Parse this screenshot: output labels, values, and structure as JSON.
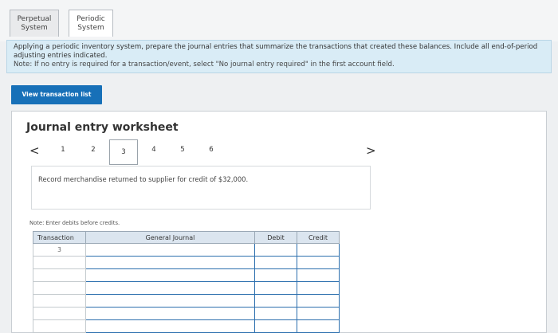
{
  "tabs": [
    {
      "label_line1": "Perpetual",
      "label_line2": "System"
    },
    {
      "label_line1": "Periodic",
      "label_line2": "System"
    }
  ],
  "instructions": {
    "line1": "Applying a periodic inventory system, prepare the journal entries that summarize the transactions that created these balances. Include all end-of-period adjusting entries indicated.",
    "note": "Note: If no entry is required for a transaction/event, select \"No journal entry required\" in the first account field."
  },
  "view_button": "View transaction list",
  "worksheet": {
    "title": "Journal entry worksheet",
    "prev": "<",
    "next": ">",
    "pages": [
      "1",
      "2",
      "3",
      "4",
      "5",
      "6"
    ],
    "active_page": "3",
    "transaction_text": "Record merchandise returned to supplier for credit of $32,000.",
    "note_debits": "Note: Enter debits before credits.",
    "table": {
      "headers": [
        "Transaction",
        "General Journal",
        "Debit",
        "Credit"
      ],
      "rows": [
        {
          "transaction": "3"
        },
        {
          "transaction": ""
        },
        {
          "transaction": ""
        },
        {
          "transaction": ""
        },
        {
          "transaction": ""
        },
        {
          "transaction": ""
        },
        {
          "transaction": ""
        }
      ]
    }
  },
  "colors": {
    "button_blue": "#1770b8",
    "instructions_bg": "#d9ecf6",
    "input_border": "#2c6fae"
  }
}
